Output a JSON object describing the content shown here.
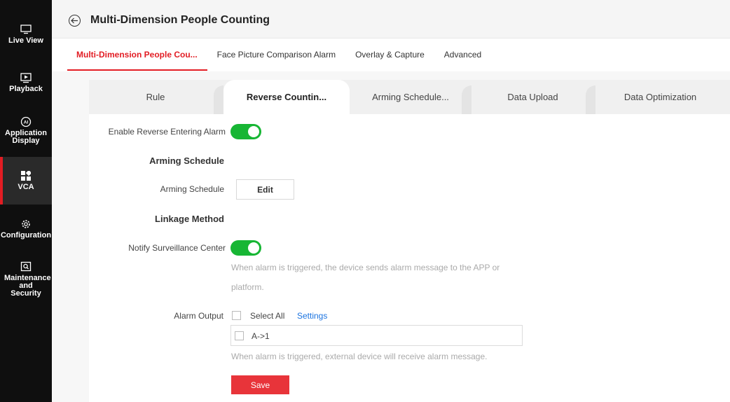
{
  "sidebar": {
    "items": [
      {
        "label": "Live View",
        "icon": "monitor-icon"
      },
      {
        "label": "Playback",
        "icon": "playback-icon"
      },
      {
        "label": "Application Display",
        "icon": "ai-icon"
      },
      {
        "label": "VCA",
        "icon": "vca-grid-icon"
      },
      {
        "label": "Configuration",
        "icon": "gear-icon"
      },
      {
        "label": "Maintenance and Security",
        "icon": "maintenance-icon"
      }
    ],
    "active_index": 3,
    "active_color": "#e21c23"
  },
  "header": {
    "title": "Multi-Dimension People Counting"
  },
  "top_tabs": [
    {
      "label": "Multi-Dimension People Cou..."
    },
    {
      "label": "Face Picture Comparison Alarm"
    },
    {
      "label": "Overlay & Capture"
    },
    {
      "label": "Advanced"
    }
  ],
  "sub_tabs": [
    {
      "label": "Rule"
    },
    {
      "label": "Reverse Countin..."
    },
    {
      "label": "Arming Schedule..."
    },
    {
      "label": "Data Upload"
    },
    {
      "label": "Data Optimization"
    }
  ],
  "form": {
    "enable_reverse_label": "Enable Reverse Entering Alarm",
    "enable_reverse_on": true,
    "arming_section": "Arming Schedule",
    "arming_label": "Arming Schedule",
    "edit_label": "Edit",
    "linkage_section": "Linkage Method",
    "notify_label": "Notify Surveillance Center",
    "notify_on": true,
    "notify_hint_line1": "When alarm is triggered, the device sends alarm message to the APP or",
    "notify_hint_line2": "platform.",
    "alarm_output_label": "Alarm Output",
    "select_all_label": "Select All",
    "settings_link": "Settings",
    "output_item": "A->1",
    "output_hint": "When alarm is triggered, external device will receive alarm message.",
    "save_label": "Save"
  },
  "colors": {
    "accent": "#e21c23",
    "toggle_on": "#17b634",
    "link": "#1c74e0",
    "save": "#e8343a"
  }
}
